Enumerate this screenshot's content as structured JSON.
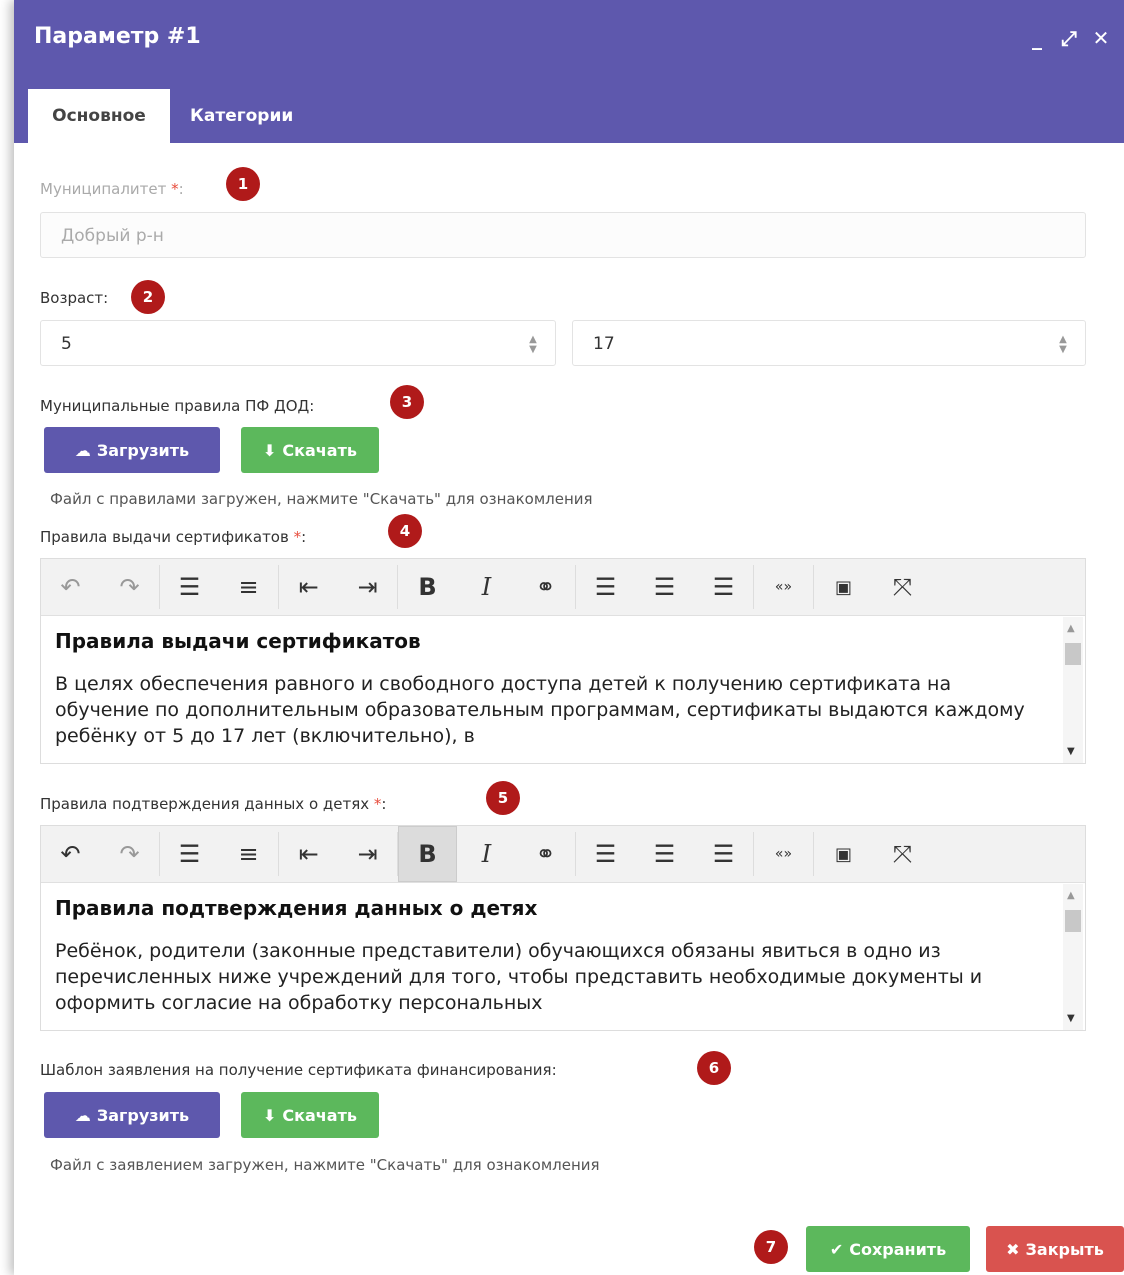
{
  "window": {
    "title": "Параметр #1",
    "controls": [
      "_",
      "⤢",
      "✕"
    ]
  },
  "tabs": [
    {
      "label": "Основное",
      "active": true
    },
    {
      "label": "Категории",
      "active": false
    }
  ],
  "badges": [
    "1",
    "2",
    "3",
    "4",
    "5",
    "6",
    "7"
  ],
  "fields": {
    "municipality": {
      "label": "Муниципалитет",
      "required": "*",
      "colon": ":",
      "value": "Добрый р-н"
    },
    "age": {
      "label": "Возраст:",
      "from": "5",
      "to": "17"
    },
    "rules_pfdod": {
      "label": "Муниципальные правила ПФ ДОД:",
      "upload": "Загрузить",
      "download": "Скачать",
      "hint": "Файл с правилами загружен, нажмите \"Скачать\" для ознакомления"
    },
    "certificate_rules": {
      "label": "Правила выдачи сертификатов",
      "required": "*",
      "colon": ":",
      "heading": "Правила выдачи сертификатов",
      "text": "В целях обеспечения равного и свободного доступа детей к получению сертификата на обучение по дополнительным образовательным программам, сертификаты выдаются каждому ребёнку от 5 до 17 лет (включительно), в"
    },
    "child_data_rules": {
      "label": "Правила подтверждения данных о детях",
      "required": "*",
      "colon": ":",
      "heading": "Правила подтверждения данных о детях",
      "text": "Ребёнок, родители (законные представители) обучающихся обязаны явиться в одно из перечисленных ниже учреждений для того, чтобы представить необходимые документы и оформить согласие на обработку персональных"
    },
    "application_template": {
      "label": "Шаблон заявления на получение сертификата финансирования:",
      "upload": "Загрузить",
      "download": "Скачать",
      "hint": "Файл с заявлением загружен, нажмите \"Скачать\" для ознакомления"
    }
  },
  "toolbar_icons": [
    "undo-icon",
    "redo-icon",
    "bullet-list-icon",
    "numbered-list-icon",
    "outdent-icon",
    "indent-icon",
    "bold-icon",
    "italic-icon",
    "link-icon",
    "align-left-icon",
    "align-center-icon",
    "align-right-icon",
    "quote-icon",
    "media-icon",
    "fullscreen-icon"
  ],
  "footer": {
    "save": "Сохранить",
    "close": "Закрыть"
  },
  "colors": {
    "header": "#5e58ad",
    "badge": "#b01a1a",
    "green": "#5cb85c",
    "red": "#d9534f",
    "required": "#e74c3c"
  }
}
